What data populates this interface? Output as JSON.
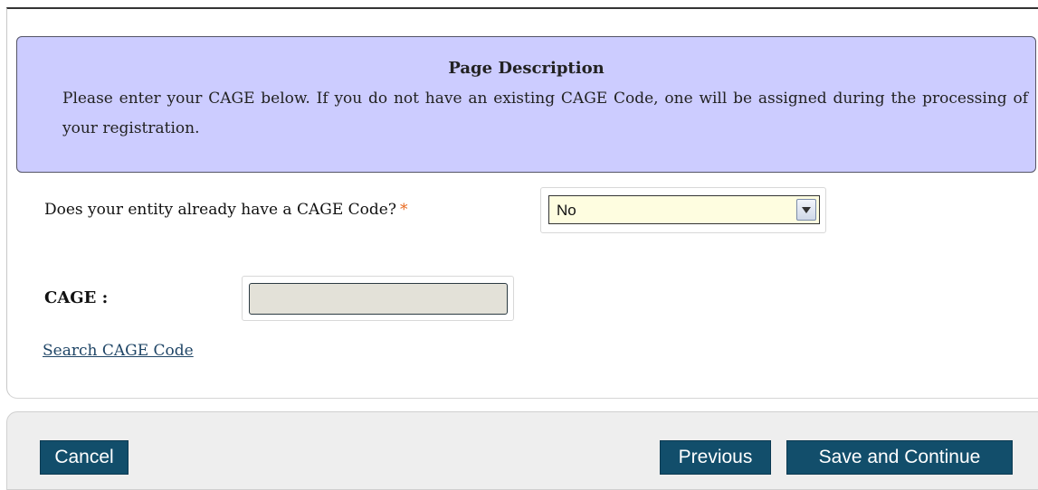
{
  "description": {
    "title": "Page Description",
    "text": "Please enter your CAGE below. If you do not have an existing CAGE Code, one will be assigned during the processing of your registration."
  },
  "question": {
    "label": "Does your entity already have a CAGE Code?",
    "required_marker": "*",
    "selected_value": "No"
  },
  "cage": {
    "label": "CAGE :",
    "value": ""
  },
  "search_link": {
    "label": "Search CAGE Code"
  },
  "footer": {
    "cancel_label": "Cancel",
    "previous_label": "Previous",
    "save_label": "Save and Continue"
  },
  "colors": {
    "description_background": "#ccccff",
    "button_background": "#124e6b",
    "required_star": "#e8691f",
    "select_background": "#fefde0",
    "cage_input_background": "#e3e1d8"
  },
  "icons": {
    "select_arrow": "chevron-down-icon"
  }
}
